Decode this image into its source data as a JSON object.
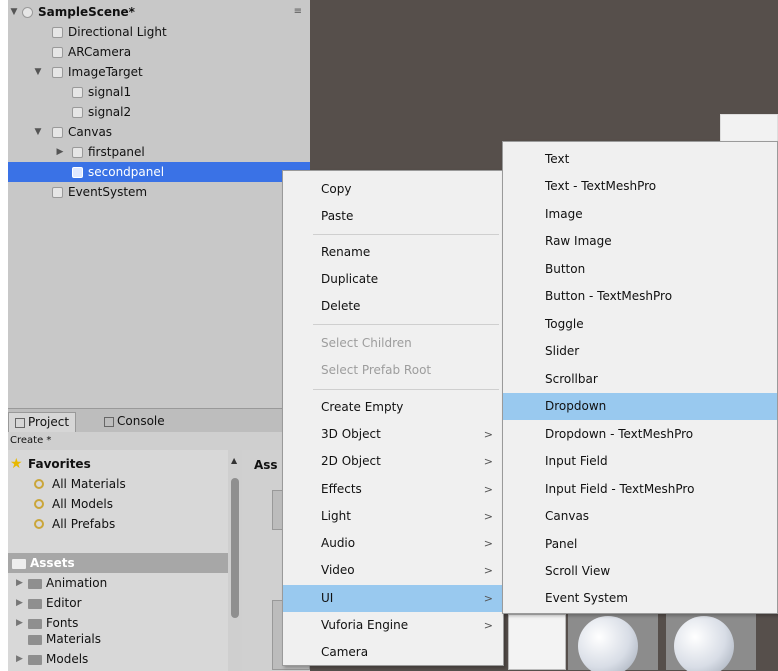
{
  "hierarchy": {
    "scene_title": "SampleScene*",
    "scene_menu": "≡",
    "items": [
      {
        "label": "Directional Light"
      },
      {
        "label": "ARCamera"
      },
      {
        "label": "ImageTarget"
      },
      {
        "label": "signal1"
      },
      {
        "label": "signal2"
      },
      {
        "label": "Canvas"
      },
      {
        "label": "firstpanel"
      },
      {
        "label": "secondpanel"
      },
      {
        "label": "EventSystem"
      }
    ]
  },
  "tabs": {
    "project": "Project",
    "console": "Console"
  },
  "create_label": "Create *",
  "project": {
    "favorites_label": "Favorites",
    "favorites": [
      "All Materials",
      "All Models",
      "All Prefabs"
    ],
    "assets_label": "Assets",
    "assets_header": "Ass",
    "folders": [
      "Animation",
      "Editor",
      "Fonts",
      "Materials",
      "Models"
    ]
  },
  "context_menu": {
    "items": [
      {
        "label": "Copy",
        "enabled": true
      },
      {
        "label": "Paste",
        "enabled": true
      },
      {
        "label": "Rename",
        "enabled": true
      },
      {
        "label": "Duplicate",
        "enabled": true
      },
      {
        "label": "Delete",
        "enabled": true
      },
      {
        "label": "Select Children",
        "enabled": false
      },
      {
        "label": "Select Prefab Root",
        "enabled": false
      },
      {
        "label": "Create Empty",
        "enabled": true
      },
      {
        "label": "3D Object",
        "enabled": true,
        "submenu": true
      },
      {
        "label": "2D Object",
        "enabled": true,
        "submenu": true
      },
      {
        "label": "Effects",
        "enabled": true,
        "submenu": true
      },
      {
        "label": "Light",
        "enabled": true,
        "submenu": true
      },
      {
        "label": "Audio",
        "enabled": true,
        "submenu": true
      },
      {
        "label": "Video",
        "enabled": true,
        "submenu": true
      },
      {
        "label": "UI",
        "enabled": true,
        "submenu": true,
        "highlighted": true
      },
      {
        "label": "Vuforia Engine",
        "enabled": true,
        "submenu": true
      },
      {
        "label": "Camera",
        "enabled": true
      }
    ],
    "submenu_arrow": ">"
  },
  "ui_submenu": {
    "items": [
      {
        "label": "Text"
      },
      {
        "label": "Text - TextMeshPro"
      },
      {
        "label": "Image"
      },
      {
        "label": "Raw Image"
      },
      {
        "label": "Button"
      },
      {
        "label": "Button - TextMeshPro"
      },
      {
        "label": "Toggle"
      },
      {
        "label": "Slider"
      },
      {
        "label": "Scrollbar"
      },
      {
        "label": "Dropdown",
        "highlighted": true
      },
      {
        "label": "Dropdown - TextMeshPro"
      },
      {
        "label": "Input Field"
      },
      {
        "label": "Input Field - TextMeshPro"
      },
      {
        "label": "Canvas"
      },
      {
        "label": "Panel"
      },
      {
        "label": "Scroll View"
      },
      {
        "label": "Event System"
      }
    ]
  },
  "colors": {
    "selection": "#3a72e6",
    "menu_highlight": "#99c9ef",
    "scene_bg": "#564f4b"
  }
}
